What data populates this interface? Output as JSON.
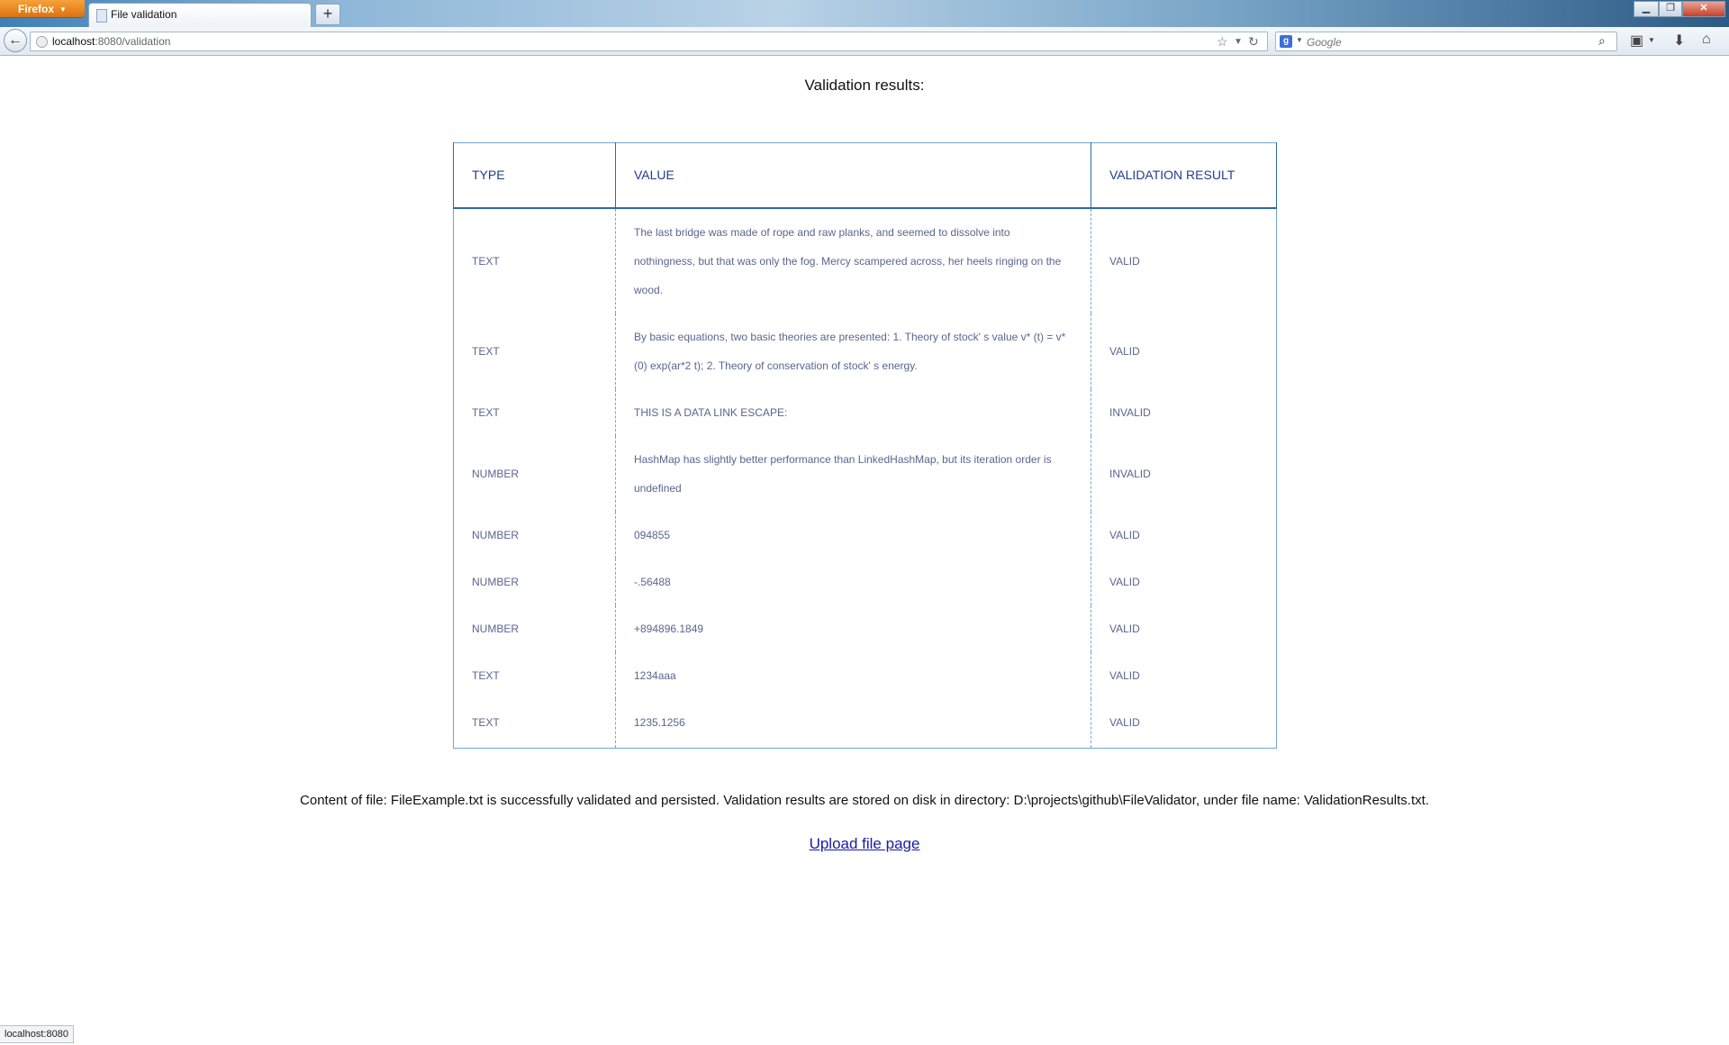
{
  "browser": {
    "app_button": "Firefox",
    "tab_title": "File validation",
    "new_tab": "+",
    "url_host": "localhost",
    "url_rest": ":8080/validation",
    "search_placeholder": "Google",
    "search_engine_letter": "g",
    "status_text": "localhost:8080"
  },
  "page": {
    "title": "Validation results:",
    "table": {
      "headers": [
        "TYPE",
        "VALUE",
        "VALIDATION RESULT"
      ],
      "rows": [
        {
          "type": "TEXT",
          "value": "The last bridge was made of rope and raw planks, and seemed to dissolve into nothingness, but that was only the fog. Mercy scampered across, her heels ringing on the wood.",
          "result": "VALID"
        },
        {
          "type": "TEXT",
          "value": "By basic equations, two basic theories are presented: 1. Theory of stock' s value v* (t) = v*(0) exp(ar*2 t); 2. Theory of conservation of stock' s energy.",
          "result": "VALID"
        },
        {
          "type": "TEXT",
          "value": "THIS IS A DATA LINK ESCAPE:",
          "result": "INVALID"
        },
        {
          "type": "NUMBER",
          "value": "HashMap has slightly better performance than LinkedHashMap, but its iteration order is undefined",
          "result": "INVALID"
        },
        {
          "type": "NUMBER",
          "value": "094855",
          "result": "VALID"
        },
        {
          "type": "NUMBER",
          "value": "-.56488",
          "result": "VALID"
        },
        {
          "type": "NUMBER",
          "value": "+894896.1849",
          "result": "VALID"
        },
        {
          "type": "TEXT",
          "value": "1234aaa",
          "result": "VALID"
        },
        {
          "type": "TEXT",
          "value": "1235.1256",
          "result": "VALID"
        }
      ]
    },
    "footer_note": "Content of file: FileExample.txt is successfully validated and persisted. Validation results are stored on disk in directory: D:\\projects\\github\\FileValidator, under file name: ValidationResults.txt.",
    "upload_link": "Upload file page"
  },
  "colors": {
    "header_text": "#1f3f8f",
    "cell_text": "#5a6590",
    "table_border": "#6ea8d8",
    "link": "#1a1aa6"
  }
}
